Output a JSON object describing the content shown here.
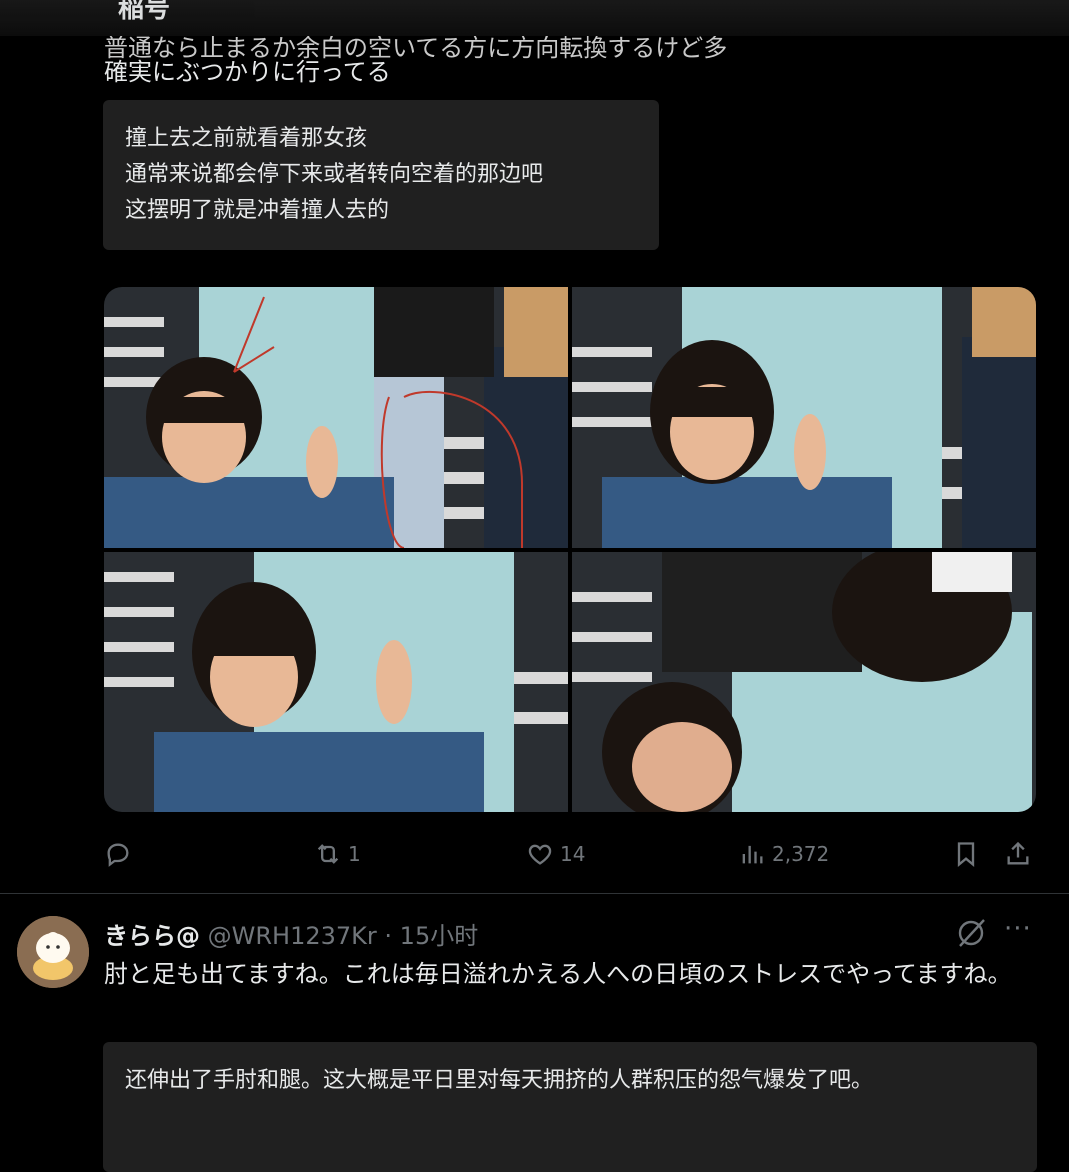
{
  "header": {
    "title_partial": "稲号"
  },
  "tweet": {
    "text_cut_line": "普通なら止まるか余白の空いてる方に方向転換するけど多",
    "text_line2": "確実にぶつかりに行ってる",
    "translation_lines": [
      "撞上去之前就看着那女孩",
      "通常来说都会停下来或者转向空着的那边吧",
      "这摆明了就是冲着撞人去的"
    ],
    "media": {
      "images": [
        {
          "desc": "girl-peace-sign-annotated"
        },
        {
          "desc": "girl-peace-sign"
        },
        {
          "desc": "girl-peace-sign-blurred"
        },
        {
          "desc": "woman-passing-child"
        }
      ]
    },
    "actions": {
      "reply_icon": "reply-icon",
      "retweet_icon": "retweet-icon",
      "retweet_count": "1",
      "like_icon": "heart-icon",
      "like_count": "14",
      "views_icon": "views-icon",
      "views_count": "2,372",
      "bookmark_icon": "bookmark-icon",
      "share_icon": "share-icon"
    }
  },
  "reply": {
    "display_name": "きらら@",
    "handle": "@WRH1237Kr",
    "separator": " · ",
    "time": "15小时",
    "text": "肘と足も出てますね。これは毎日溢れかえる人への日頃のストレスでやってますね。",
    "translation": "还伸出了手肘和腿。这大概是平日里对每天拥挤的人群积压的怨气爆发了吧。",
    "grok_icon": "grok-icon",
    "more_label": "···"
  },
  "colors": {
    "background": "#000000",
    "text": "#e7e9ea",
    "muted": "#71767b",
    "translation_bg": "#202020",
    "divider": "#2f3336"
  }
}
